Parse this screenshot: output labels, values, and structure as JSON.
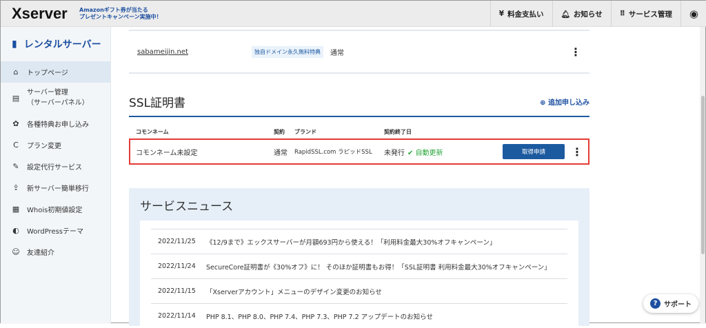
{
  "header": {
    "logo": "Xserver",
    "promo_line1": "Amazonギフト券が当たる",
    "promo_line2": "プレゼントキャンペーン実施中！",
    "payment": "料金支払い",
    "notice": "お知らせ",
    "service": "サービス管理"
  },
  "sidebar": {
    "title": "レンタルサーバー",
    "items": [
      {
        "label": "トップページ",
        "icon": "⌂"
      },
      {
        "label": "サーバー管理",
        "sub": "（サーバーパネル）",
        "icon": "▤"
      },
      {
        "label": "各種特典お申し込み",
        "icon": "✿"
      },
      {
        "label": "プラン変更",
        "icon": "C"
      },
      {
        "label": "設定代行サービス",
        "icon": "✎"
      },
      {
        "label": "新サーバー簡単移行",
        "icon": "⇪"
      },
      {
        "label": "Whois初期値設定",
        "icon": "▦"
      },
      {
        "label": "WordPressテーマ",
        "icon": "◐"
      },
      {
        "label": "友達紹介",
        "icon": "☺"
      }
    ]
  },
  "domain_row": {
    "domain": "sabameijin.net",
    "tag": "独自ドメイン永久無料特典",
    "contract": "通常"
  },
  "ssl": {
    "title": "SSL証明書",
    "add": "追加申し込み",
    "headers": {
      "common_name": "コモンネーム",
      "contract": "契約",
      "brand": "ブランド",
      "end_date": "契約終了日"
    },
    "row": {
      "common_name": "コモンネーム未設定",
      "contract": "通常",
      "brand": "RapidSSL.com ラピッドSSL",
      "status": "未発行",
      "auto": "自動更新",
      "button": "取得申請"
    }
  },
  "news": {
    "title": "サービスニュース",
    "items": [
      {
        "date": "2022/11/25",
        "text": "《12/9まで》エックスサーバーが月額693円から使える！「利用料金最大30%オフキャンペーン」"
      },
      {
        "date": "2022/11/24",
        "text": "SecureCore証明書が《30%オフ》に！ そのほか証明書もお得！「SSL証明書 利用料金最大30%オフキャンペーン」"
      },
      {
        "date": "2022/11/15",
        "text": "「Xserverアカウント」メニューのデザイン変更のお知らせ"
      },
      {
        "date": "2022/11/14",
        "text": "PHP 8.1、PHP 8.0、PHP 7.4、PHP 7.3、PHP 7.2 アップデートのお知らせ"
      }
    ]
  },
  "support": "サポート"
}
